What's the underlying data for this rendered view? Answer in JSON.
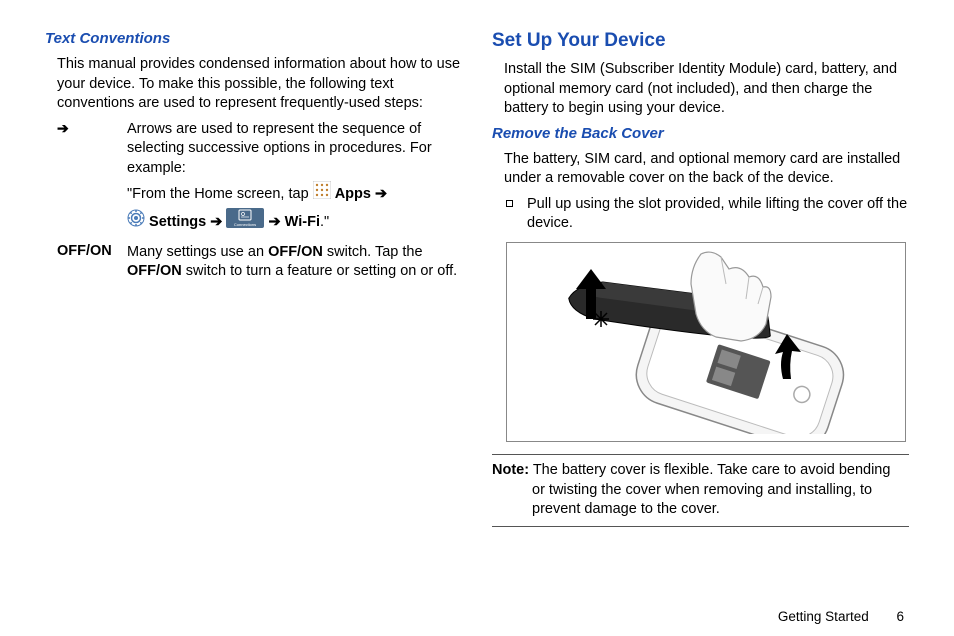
{
  "left": {
    "heading1": "Text Conventions",
    "para1": "This manual provides condensed information about how to use your device. To make this possible, the following text conventions are used to represent frequently-used steps:",
    "arrow_symbol": "➔",
    "arrow_desc": "Arrows are used to represent the sequence of selecting successive options in procedures. For example:",
    "example_prefix": "\"From the Home screen, tap ",
    "apps_label": "Apps",
    "arrow_mid": "➔",
    "settings_label": "Settings",
    "arrow_mid2": "➔",
    "arrow_mid3": "➔",
    "wifi_label": "Wi-Fi",
    "example_suffix": ".\"",
    "offon_label": "OFF/ON",
    "offon_desc_1": "Many settings use an ",
    "offon_bold1": "OFF/ON",
    "offon_desc_2": " switch. Tap the ",
    "offon_bold2": "OFF/ON",
    "offon_desc_3": " switch to turn a feature or setting on or off."
  },
  "right": {
    "heading1": "Set Up Your Device",
    "para1": "Install the SIM (Subscriber Identity Module) card, battery, and optional memory card (not included), and then charge the battery to begin using your device.",
    "heading2": "Remove the Back Cover",
    "para2": "The battery, SIM card, and optional memory card are installed under a removable cover on the back of the device.",
    "bullet1": "Pull up using the slot provided, while lifting the cover off the device.",
    "note_label": "Note:",
    "note_text_1": " The battery cover is flexible. Take care to avoid bending ",
    "note_text_2": "or twisting the cover when removing and installing, to prevent damage to the cover."
  },
  "footer": {
    "section": "Getting Started",
    "page": "6"
  }
}
